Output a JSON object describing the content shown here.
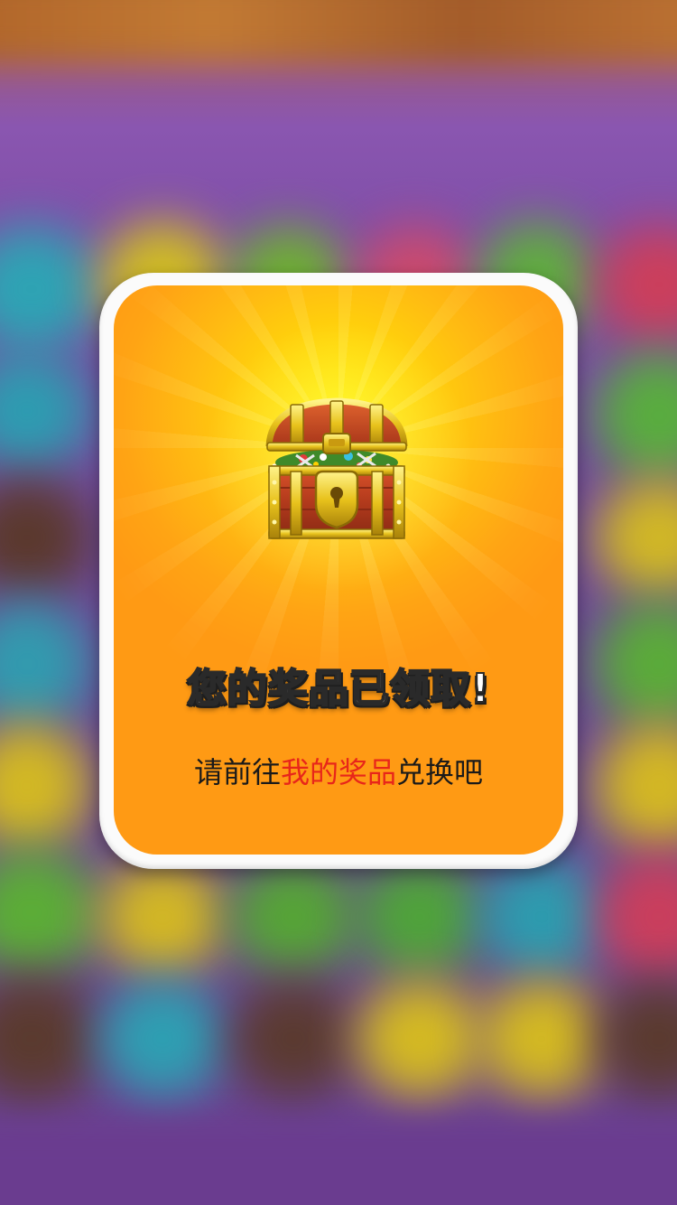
{
  "dialog": {
    "title": "您的奖品已领取!",
    "message_prefix": "请前往",
    "message_link": "我的奖品",
    "message_suffix": "兑换吧",
    "icon": "treasure-chest-icon"
  },
  "colors": {
    "card_border": "#fbfbfb",
    "card_center": "#fff000",
    "card_edge": "#ff9a14",
    "link_text": "#e8261a",
    "body_text": "#1a1a1a"
  }
}
